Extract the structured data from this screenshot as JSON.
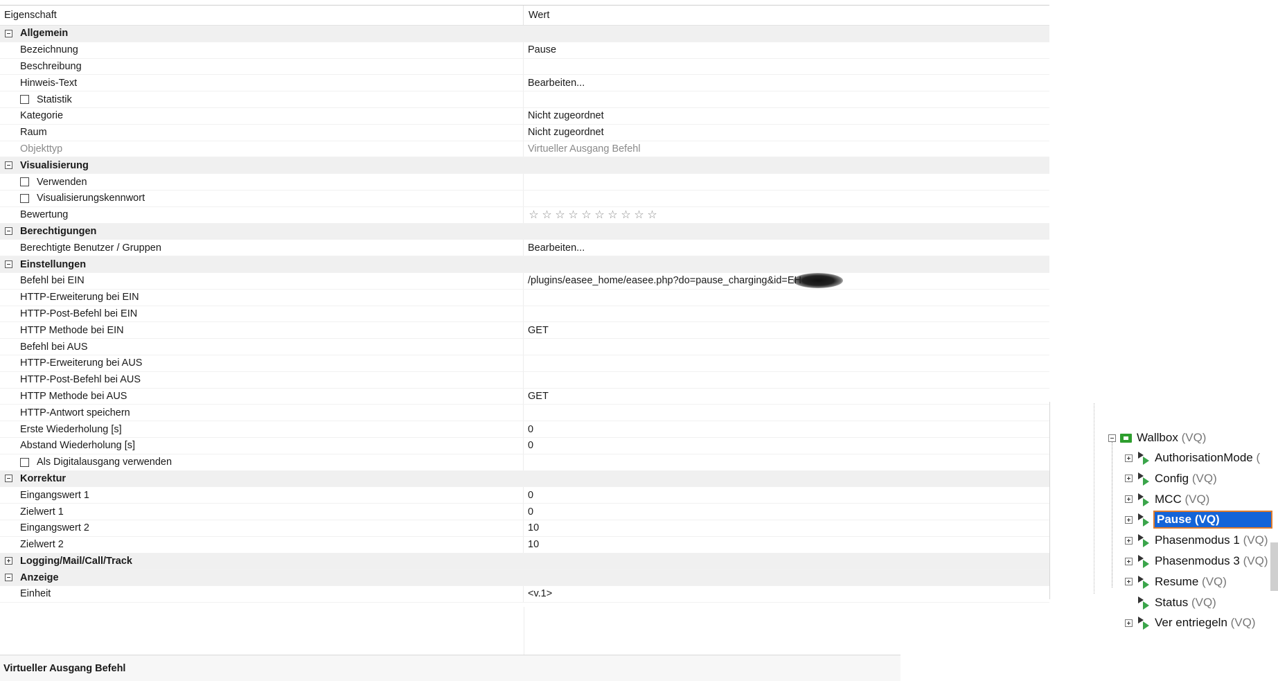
{
  "grid": {
    "header": {
      "property": "Eigenschaft",
      "value": "Wert"
    },
    "rows": [
      {
        "kind": "group",
        "label": "Allgemein",
        "expander": "minus"
      },
      {
        "kind": "item",
        "label": "Bezeichnung",
        "value": "Pause"
      },
      {
        "kind": "item",
        "label": "Beschreibung",
        "value": ""
      },
      {
        "kind": "item",
        "label": "Hinweis-Text",
        "value": "Bearbeiten..."
      },
      {
        "kind": "check",
        "label": "Statistik",
        "value": ""
      },
      {
        "kind": "item",
        "label": "Kategorie",
        "value": "Nicht zugeordnet"
      },
      {
        "kind": "item",
        "label": "Raum",
        "value": "Nicht zugeordnet"
      },
      {
        "kind": "disabled",
        "label": "Objekttyp",
        "value": "Virtueller Ausgang Befehl"
      },
      {
        "kind": "group",
        "label": "Visualisierung",
        "expander": "minus"
      },
      {
        "kind": "check",
        "label": "Verwenden",
        "value": ""
      },
      {
        "kind": "check",
        "label": "Visualisierungskennwort",
        "value": ""
      },
      {
        "kind": "stars",
        "label": "Bewertung",
        "stars": 10,
        "rating": 0
      },
      {
        "kind": "group",
        "label": "Berechtigungen",
        "expander": "minus"
      },
      {
        "kind": "item",
        "label": "Berechtigte Benutzer / Gruppen",
        "value": "Bearbeiten..."
      },
      {
        "kind": "group",
        "label": "Einstellungen",
        "expander": "minus"
      },
      {
        "kind": "redacted",
        "label": "Befehl bei EIN",
        "value": "/plugins/easee_home/easee.php?do=pause_charging&id=EH"
      },
      {
        "kind": "item",
        "label": "HTTP-Erweiterung bei EIN",
        "value": ""
      },
      {
        "kind": "item",
        "label": "HTTP-Post-Befehl bei EIN",
        "value": ""
      },
      {
        "kind": "item",
        "label": "HTTP Methode bei EIN",
        "value": "GET"
      },
      {
        "kind": "item",
        "label": "Befehl bei AUS",
        "value": ""
      },
      {
        "kind": "item",
        "label": "HTTP-Erweiterung bei AUS",
        "value": ""
      },
      {
        "kind": "item",
        "label": "HTTP-Post-Befehl bei AUS",
        "value": ""
      },
      {
        "kind": "item",
        "label": "HTTP Methode bei AUS",
        "value": "GET"
      },
      {
        "kind": "item",
        "label": "HTTP-Antwort speichern",
        "value": ""
      },
      {
        "kind": "item",
        "label": "Erste Wiederholung [s]",
        "value": "0"
      },
      {
        "kind": "item",
        "label": "Abstand Wiederholung [s]",
        "value": "0"
      },
      {
        "kind": "check",
        "label": "Als Digitalausgang verwenden",
        "value": ""
      },
      {
        "kind": "group",
        "label": "Korrektur",
        "expander": "minus"
      },
      {
        "kind": "item",
        "label": "Eingangswert 1",
        "value": "0"
      },
      {
        "kind": "item",
        "label": "Zielwert 1",
        "value": "0"
      },
      {
        "kind": "item",
        "label": "Eingangswert 2",
        "value": "10"
      },
      {
        "kind": "item",
        "label": "Zielwert 2",
        "value": "10"
      },
      {
        "kind": "group",
        "label": "Logging/Mail/Call/Track",
        "expander": "plus"
      },
      {
        "kind": "group",
        "label": "Anzeige",
        "expander": "minus"
      },
      {
        "kind": "item",
        "label": "Einheit",
        "value": "<v.1>"
      }
    ]
  },
  "statusbar": {
    "text": "Virtueller Ausgang Befehl"
  },
  "tree": {
    "root": {
      "label": "Wallbox",
      "suffix": "(VQ)"
    },
    "items": [
      {
        "label": "AuthorisationMode",
        "suffix": "(",
        "expander": "plus"
      },
      {
        "label": "Config",
        "suffix": "(VQ)",
        "expander": "plus"
      },
      {
        "label": "MCC",
        "suffix": "(VQ)",
        "expander": "plus"
      },
      {
        "label": "Pause",
        "suffix": "(VQ)",
        "expander": "plus",
        "selected": true
      },
      {
        "label": "Phasenmodus 1",
        "suffix": "(VQ)",
        "expander": "plus"
      },
      {
        "label": "Phasenmodus 3",
        "suffix": "(VQ)",
        "expander": "plus"
      },
      {
        "label": "Resume",
        "suffix": "(VQ)",
        "expander": "plus"
      },
      {
        "label": "Status",
        "suffix": "(VQ)",
        "expander": "none"
      },
      {
        "label": "Ver entriegeln",
        "suffix": "(VQ)",
        "expander": "plus"
      }
    ]
  },
  "icons": {
    "expander": "tree-expander-icon",
    "checkbox": "checkbox-icon",
    "star": "star-icon",
    "wallbox": "wallbox-icon",
    "virtual-output": "virtual-output-icon"
  },
  "colors": {
    "selection": "#1464d8",
    "selection_border": "#e07b2a",
    "wallbox_icon": "#2e9e2e",
    "group_bg": "#f0f0f0"
  }
}
